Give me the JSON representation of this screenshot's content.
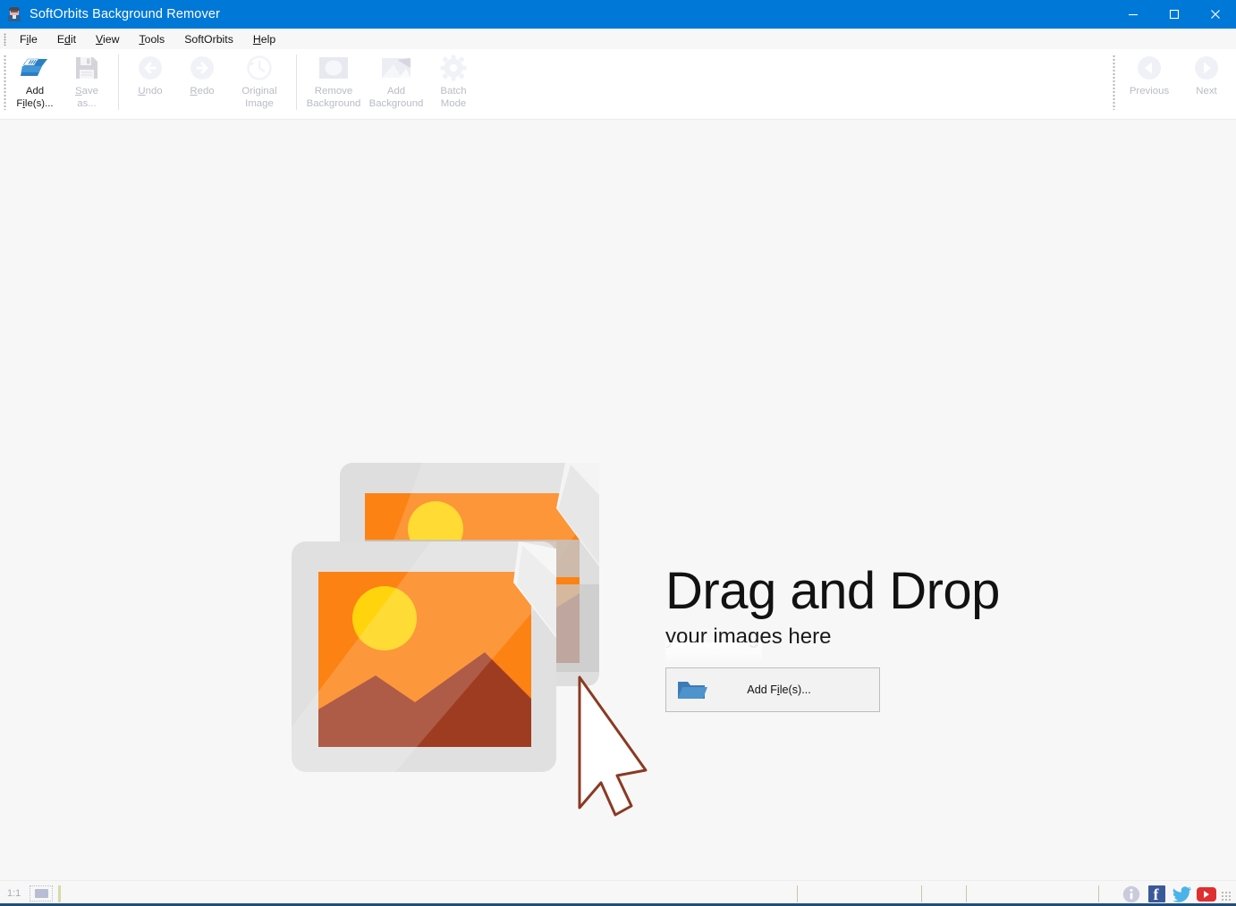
{
  "window": {
    "title": "SoftOrbits Background Remover",
    "icon": "app-avatar-icon",
    "controls": {
      "minimize": "minimize-icon",
      "maximize": "maximize-icon",
      "close": "close-icon"
    },
    "titlebar_color": "#0078d7"
  },
  "menubar": {
    "items": [
      {
        "label": "File",
        "pre": "F",
        "accel": "i",
        "post": "le"
      },
      {
        "label": "Edit",
        "pre": "E",
        "accel": "d",
        "post": "it"
      },
      {
        "label": "View",
        "pre": "",
        "accel": "V",
        "post": "iew"
      },
      {
        "label": "Tools",
        "pre": "",
        "accel": "T",
        "post": "ools"
      },
      {
        "label": "SoftOrbits",
        "pre": "SoftOrbits",
        "accel": "",
        "post": ""
      },
      {
        "label": "Help",
        "pre": "",
        "accel": "H",
        "post": "elp"
      }
    ]
  },
  "toolbar": {
    "groups": [
      {
        "buttons": [
          {
            "label_line1": "Add",
            "label_line2": "File(s)...",
            "accel": "i",
            "icon": "add-files-icon",
            "enabled": true,
            "name": "add-files"
          },
          {
            "label_line1": "Save",
            "label_line2": "as...",
            "accel": "S",
            "icon": "save-as-icon",
            "enabled": false,
            "name": "save-as"
          }
        ]
      },
      {
        "buttons": [
          {
            "label_line1": "Undo",
            "label_line2": "",
            "accel": "U",
            "icon": "undo-arrow-icon",
            "enabled": false,
            "name": "undo"
          },
          {
            "label_line1": "Redo",
            "label_line2": "",
            "accel": "R",
            "icon": "redo-arrow-icon",
            "enabled": false,
            "name": "redo"
          },
          {
            "label_line1": "Original",
            "label_line2": "Image",
            "accel": "",
            "icon": "clock-history-icon",
            "enabled": false,
            "name": "original-image"
          }
        ]
      },
      {
        "buttons": [
          {
            "label_line1": "Remove",
            "label_line2": "Background",
            "accel": "",
            "icon": "remove-background-icon",
            "enabled": false,
            "name": "remove-background"
          },
          {
            "label_line1": "Add",
            "label_line2": "Background",
            "accel": "",
            "icon": "add-background-icon",
            "enabled": false,
            "name": "add-background"
          },
          {
            "label_line1": "Batch",
            "label_line2": "Mode",
            "accel": "",
            "icon": "gear-icon",
            "enabled": false,
            "name": "batch-mode"
          }
        ]
      }
    ],
    "nav": [
      {
        "label": "Previous",
        "icon": "chevron-left-circle-icon",
        "enabled": false,
        "name": "previous-image"
      },
      {
        "label": "Next",
        "icon": "chevron-right-circle-icon",
        "enabled": false,
        "name": "next-image"
      }
    ],
    "overflow_icon": "toolbar-overflow-icon"
  },
  "dropzone": {
    "illustration": "two-photos-with-cursor-illustration",
    "title": "Drag and Drop",
    "subtitle": "your images here",
    "button": {
      "icon": "folder-open-icon",
      "pre": "Add F",
      "accel": "i",
      "post": "le(s)..."
    }
  },
  "statusbar": {
    "zoom": "1:1",
    "fit_icon": "fit-to-window-icon",
    "info_icon": "info-circle-icon",
    "facebook_icon": "facebook-icon",
    "twitter_icon": "twitter-icon",
    "youtube_icon": "youtube-icon",
    "resize_grip": "resize-grip-icon",
    "accent_color": "#1f4e79"
  },
  "palette": {
    "accent": "#0078d7",
    "canvas_bg": "#f7f7f7",
    "toolbar_bg": "#ffffff",
    "orange": "#fc8214",
    "orange_light": "#ff9a2e",
    "yellow": "#ffd40d",
    "brown": "#9e3c22",
    "gray_frame": "#dedede",
    "status_accent": "#1f4e79"
  }
}
